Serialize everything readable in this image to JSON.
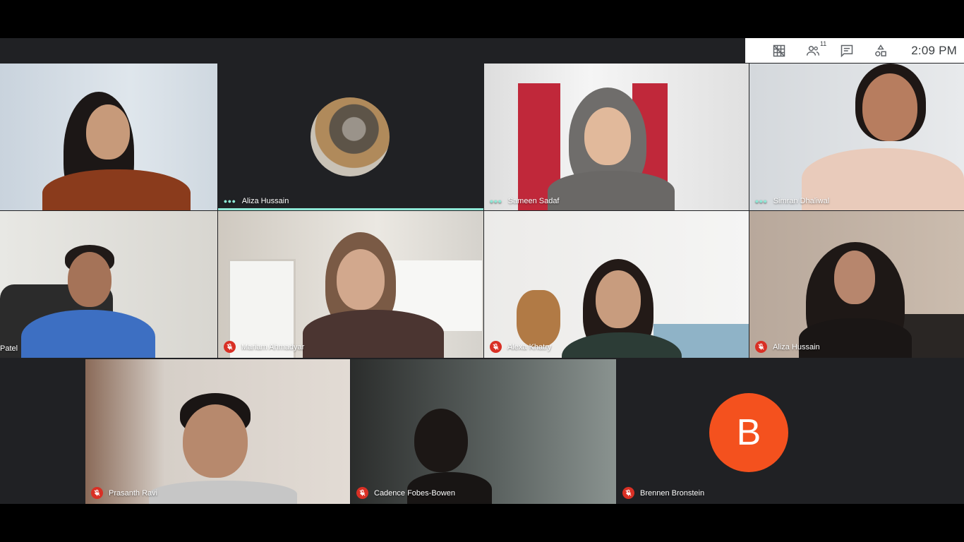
{
  "toolbar": {
    "participant_count": "11",
    "time": "2:09  PM",
    "icons": [
      "layout-grid-icon",
      "people-icon",
      "chat-icon",
      "activities-icon"
    ]
  },
  "tiles": [
    {
      "name": "",
      "muted": false,
      "speaking": false
    },
    {
      "name": "Aliza Hussain",
      "muted": false,
      "speaking": true
    },
    {
      "name": "Sameen Sadaf",
      "muted": false,
      "speaking": false
    },
    {
      "name": "Simran Dhaliwal",
      "muted": false,
      "speaking": false
    },
    {
      "name": "Patel",
      "muted": false,
      "speaking": false
    },
    {
      "name": "Mariam Ahmadyar",
      "muted": true,
      "speaking": false
    },
    {
      "name": "Alexa Khatry",
      "muted": true,
      "speaking": false
    },
    {
      "name": "Aliza Hussain",
      "muted": true,
      "speaking": false
    },
    {
      "name": "Prasanth Ravi",
      "muted": true,
      "speaking": false
    },
    {
      "name": "Cadence Fobes-Bowen",
      "muted": true,
      "speaking": false
    },
    {
      "name": "Brennen Bronstein",
      "muted": true,
      "speaking": false,
      "avatar_letter": "B"
    }
  ],
  "colors": {
    "accent": "#8ee8d6",
    "mute_red": "#d93025",
    "avatar_orange": "#f4511e",
    "background": "#202124"
  }
}
